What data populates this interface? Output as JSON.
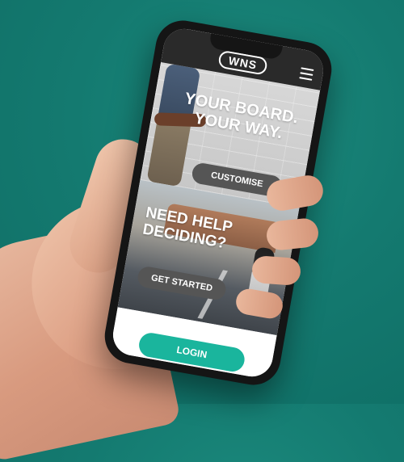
{
  "app": {
    "logo_text": "WNS",
    "menu_icon": "hamburger-menu-icon"
  },
  "hero": {
    "title_line1": "YOUR BOARD.",
    "title_line2": "YOUR WAY.",
    "cta_label": "CUSTOMISE"
  },
  "help": {
    "title_line1": "NEED HELP",
    "title_line2": "DECIDING?",
    "cta_label": "GET STARTED"
  },
  "auth": {
    "login_label": "LOGIN"
  },
  "system_nav": {
    "recent_icon": "square-icon",
    "home_icon": "circle-icon",
    "back_icon": "triangle-back-icon"
  },
  "colors": {
    "background": "#147a70",
    "login_button": "#1ab59d",
    "cta_pill": "#555555"
  }
}
